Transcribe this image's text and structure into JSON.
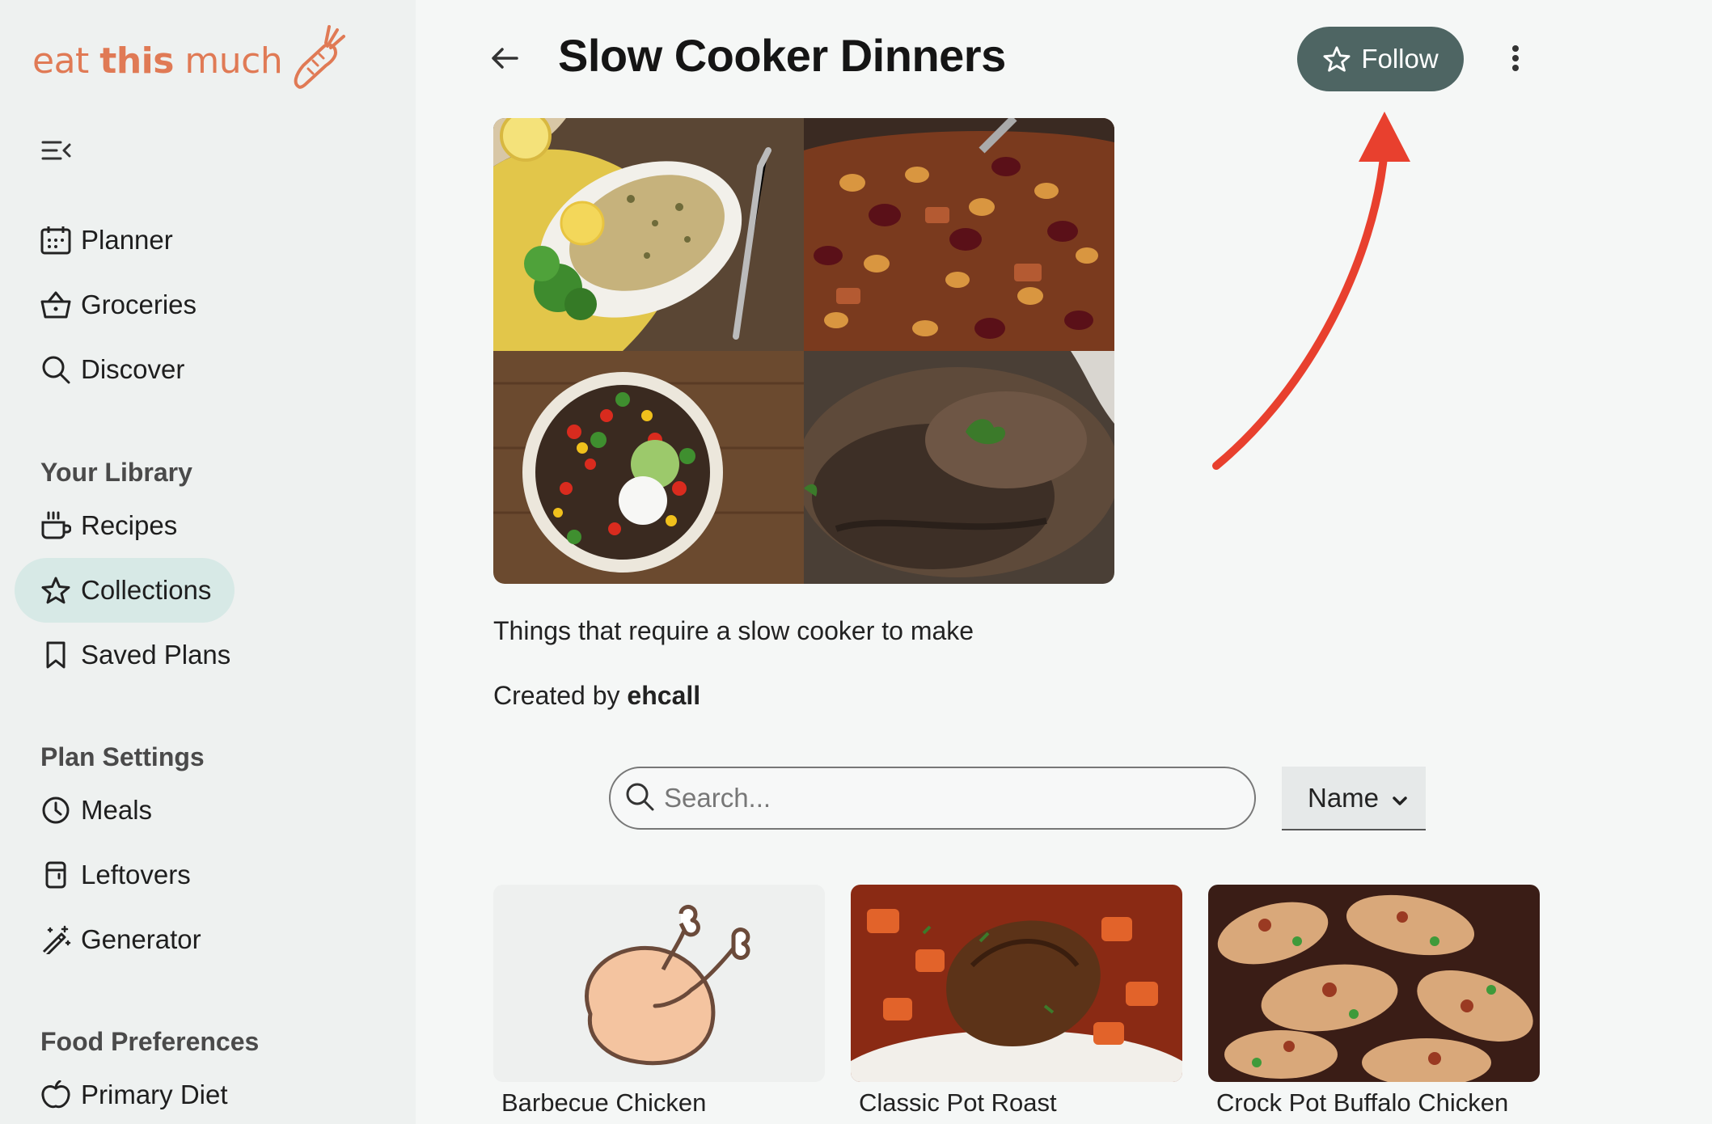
{
  "brand": {
    "logo_light": "eat ",
    "logo_bold": "this",
    "logo_light2": " much"
  },
  "sidebar": {
    "primary": [
      {
        "label": "Planner",
        "icon": "calendar-icon"
      },
      {
        "label": "Groceries",
        "icon": "basket-icon"
      },
      {
        "label": "Discover",
        "icon": "search-icon"
      }
    ],
    "library_title": "Your Library",
    "library": [
      {
        "label": "Recipes",
        "icon": "cup-icon"
      },
      {
        "label": "Collections",
        "icon": "star-icon",
        "active": true
      },
      {
        "label": "Saved Plans",
        "icon": "bookmark-icon"
      }
    ],
    "settings_title": "Plan Settings",
    "settings": [
      {
        "label": "Meals",
        "icon": "clock-icon"
      },
      {
        "label": "Leftovers",
        "icon": "container-icon"
      },
      {
        "label": "Generator",
        "icon": "magic-wand-icon"
      }
    ],
    "food_title": "Food Preferences",
    "food": [
      {
        "label": "Primary Diet",
        "icon": "apple-icon"
      }
    ]
  },
  "header": {
    "title": "Slow Cooker Dinners",
    "follow_label": "Follow"
  },
  "collection": {
    "description": "Things that require a slow cooker to make",
    "created_prefix": "Created by ",
    "author": "ehcall"
  },
  "search": {
    "placeholder": "Search..."
  },
  "sort": {
    "selected": "Name"
  },
  "recipes": [
    {
      "title": "Barbecue Chicken"
    },
    {
      "title": "Classic Pot Roast"
    },
    {
      "title": "Crock Pot Buffalo Chicken"
    }
  ],
  "colors": {
    "brand": "#e07a55",
    "follow_button": "#4e6563",
    "active_nav": "#d7e9e6",
    "annotation_arrow": "#e8402e"
  }
}
